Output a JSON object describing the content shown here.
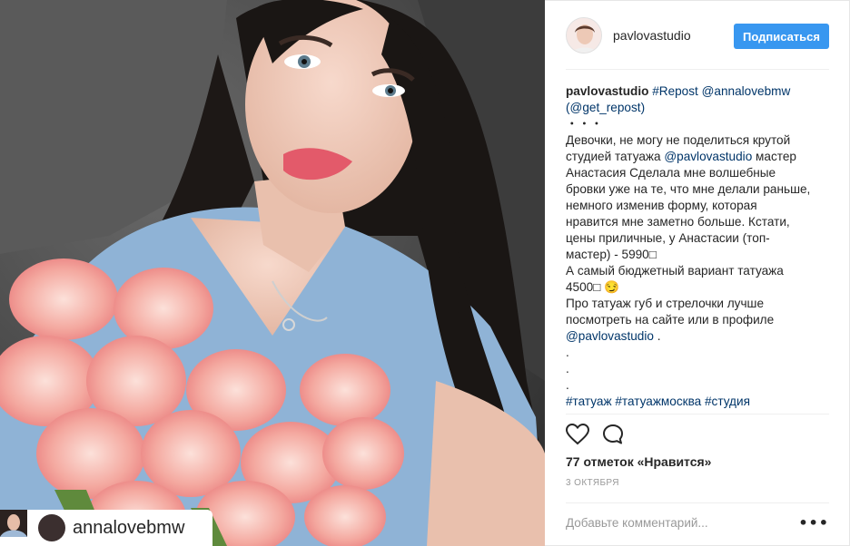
{
  "post": {
    "author": "pavlovastudio",
    "follow_label": "Подписаться",
    "repost_user": "annalovebmw",
    "caption": {
      "author": "pavlovastudio",
      "hashtag_repost": "#Repost",
      "mention_1": "@annalovebmw",
      "mention_2": "(@get_repost)",
      "dots": "・・・",
      "text_1": "Девочки, не могу не поделиться крутой студией татуажа ",
      "mention_3": "@pavlovastudio",
      "text_2": " мастер Анастасия Сделала мне волшебные бровки уже на те, что мне делали раньше, немного изменив форму, которая нравится мне заметно больше. Кстати, цены приличные, у Анастасии (топ-мастер) - 5990□\nА самый бюджетный вариант татуажа 4500□ 😏\nПро татуаж губ и стрелочки лучше посмотреть на сайте или в профиле ",
      "mention_4": "@pavlovastudio",
      "text_3": " .\n.\n.\n.",
      "hashtags": "#татуаж #татуажмосква #студия"
    },
    "likes": "77 отметок «Нравится»",
    "date": "3 ОКТЯБРЯ",
    "comment_placeholder": "Добавьте комментарий...",
    "more_label": "•••"
  },
  "colors": {
    "follow_button": "#3897f0",
    "link": "#003569"
  },
  "icons": {
    "like": "heart-icon",
    "comment": "comment-bubble-icon",
    "repost": "repost-icon"
  }
}
